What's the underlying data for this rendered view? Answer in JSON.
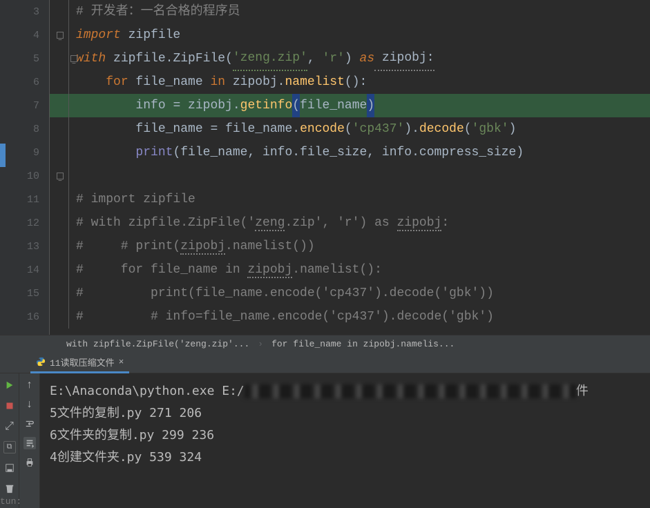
{
  "gutter": {
    "start": 3,
    "lines": [
      3,
      4,
      5,
      6,
      7,
      8,
      9,
      10,
      11,
      12,
      13,
      14,
      15,
      16
    ]
  },
  "code": {
    "l3": "# 开发者：一名合格的程序员",
    "l4": {
      "kw": "import",
      "mod": "zipfile"
    },
    "l5": {
      "kw1": "with",
      "obj": "zipfile.",
      "cls": "ZipFile(",
      "s1": "'zeng.zip'",
      "c1": ", ",
      "s2": "'r'",
      "p": ") ",
      "kw2": "as",
      "v": " zipobj:"
    },
    "l6": {
      "kw": "for",
      "v1": " file_name ",
      "kw2": "in",
      "v2": " zipobj.",
      "m": "namelist",
      "p": "():"
    },
    "l7": {
      "v1": "info ",
      "eq": "=",
      "v2": " zipobj.",
      "m": "getinfo",
      "po": "(",
      "arg": "file_name",
      "pc": ")"
    },
    "l8": {
      "v1": "file_name ",
      "eq": "=",
      "v2": " file_name.",
      "m1": "encode",
      "p1": "(",
      "s1": "'cp437'",
      "p2": ").",
      "m2": "decode",
      "p3": "(",
      "s2": "'gbk'",
      "p4": ")"
    },
    "l9": {
      "fn": "print",
      "p": "(file_name, info.file_size, info.compress_size)"
    },
    "l11": "# import zipfile",
    "l12": "# with zipfile.ZipFile('zeng.zip', 'r') as zipobj:",
    "l13": "#     # print(zipobj.namelist())",
    "l14": "#     for file_name in zipobj.namelist():",
    "l15": "#         print(file_name.encode('cp437').decode('gbk'))",
    "l16": "#         # info=file_name.encode('cp437').decode('gbk')"
  },
  "breadcrumb": {
    "seg1": "with zipfile.ZipFile('zeng.zip'...",
    "seg2": "for file_name in zipobj.namelis..."
  },
  "run_label_sidebar": "tun:",
  "run_tab": "11读取压缩文件",
  "console": {
    "l1a": "E:\\Anaconda\\python.exe E:/",
    "l1b": "件",
    "l2": "5文件的复制.py 271 206",
    "l3": "6文件夹的复制.py 299 236",
    "l4": "4创建文件夹.py 539 324"
  }
}
